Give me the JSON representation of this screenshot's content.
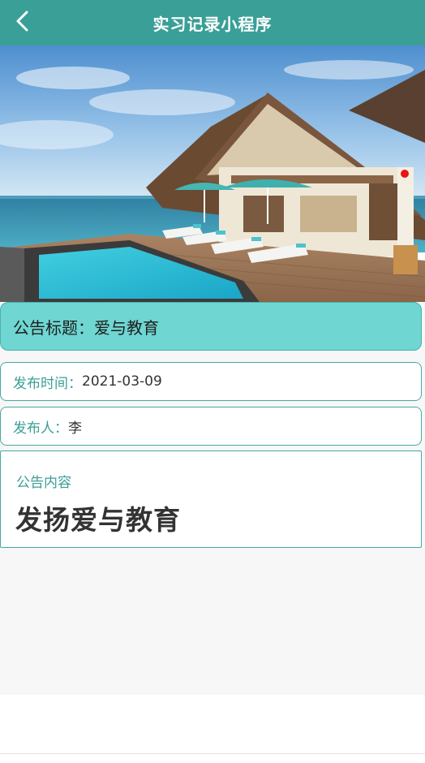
{
  "header": {
    "title": "实习记录小程序",
    "back_icon": "chevron-left-icon",
    "background_color": "#3a9f97"
  },
  "notice": {
    "title_label": "公告标题：",
    "title_value": "爱与教育",
    "publish_time_label": "发布时间：",
    "publish_time_value": "2021-03-09",
    "publisher_label": "发布人：",
    "publisher_value": "李",
    "content_label": "公告内容",
    "content_value": "发扬爱与教育"
  },
  "colors": {
    "accent": "#3a9f97",
    "title_card": "#6fd6d2"
  }
}
